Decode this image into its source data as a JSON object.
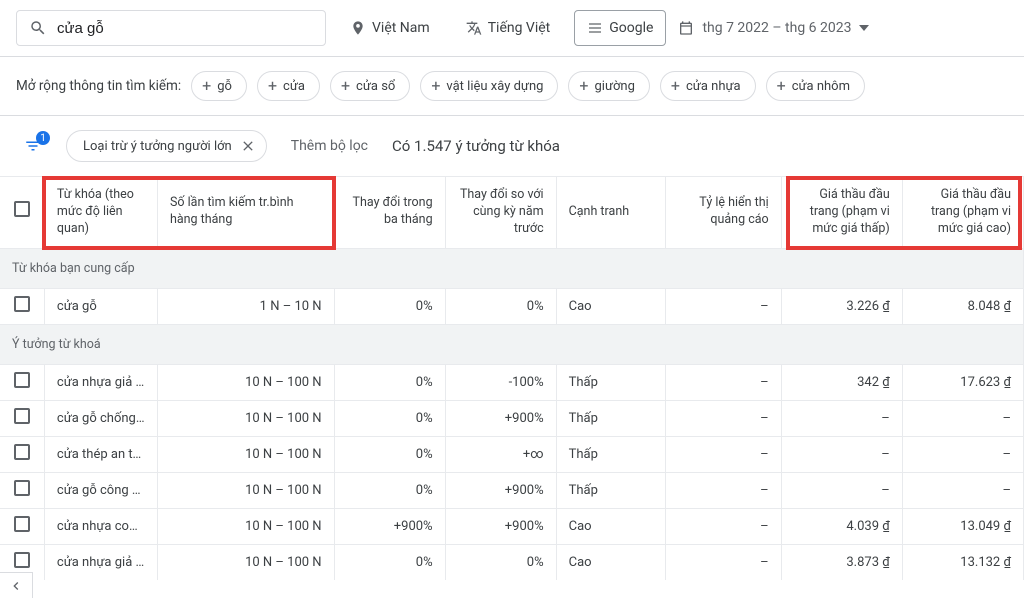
{
  "search": {
    "value": "cửa gỗ"
  },
  "top_filters": {
    "location": "Việt Nam",
    "language": "Tiếng Việt",
    "network": "Google",
    "date_range": "thg 7 2022 – thg 6 2023"
  },
  "broaden": {
    "label": "Mở rộng thông tin tìm kiếm:",
    "chips": [
      "gỗ",
      "cửa",
      "cửa sổ",
      "vật liệu xây dựng",
      "giường",
      "cửa nhựa",
      "cửa nhôm"
    ]
  },
  "filter_bar": {
    "badge": "1",
    "pill": "Loại trừ ý tưởng người lớn",
    "add_filter": "Thêm bộ lọc",
    "count": "Có 1.547 ý tưởng từ khóa"
  },
  "columns": {
    "keyword": "Từ khóa (theo mức độ liên quan)",
    "volume": "Số lần tìm kiếm tr.bình hàng tháng",
    "three_month": "Thay đổi trong ba tháng",
    "yoy": "Thay đổi so với cùng kỳ năm trước",
    "competition": "Cạnh tranh",
    "impression_share": "Tỷ lệ hiển thị quảng cáo",
    "bid_low": "Giá thầu đầu trang (phạm vi mức giá thấp)",
    "bid_high": "Giá thầu đầu trang (phạm vi mức giá cao)"
  },
  "sections": {
    "provided": "Từ khóa bạn cung cấp",
    "ideas": "Ý tưởng từ khoá"
  },
  "rows": {
    "provided": [
      {
        "kw": "cửa gỗ",
        "vol": "1 N – 10 N",
        "m3": "0%",
        "yoy": "0%",
        "comp": "Cao",
        "imp": "–",
        "low": "3.226 ₫",
        "high": "8.048 ₫"
      }
    ],
    "ideas": [
      {
        "kw": "cửa nhựa giả gỗ ...",
        "vol": "10 N – 100 N",
        "m3": "0%",
        "yoy": "-100%",
        "comp": "Thấp",
        "imp": "–",
        "low": "342 ₫",
        "high": "17.623 ₫"
      },
      {
        "kw": "cửa gỗ chống ch...",
        "vol": "10 N – 100 N",
        "m3": "0%",
        "yoy": "+900%",
        "comp": "Thấp",
        "imp": "–",
        "low": "–",
        "high": "–"
      },
      {
        "kw": "cửa thép an toàn...",
        "vol": "10 N – 100 N",
        "m3": "0%",
        "yoy": "+∞",
        "comp": "Thấp",
        "imp": "–",
        "low": "–",
        "high": "–"
      },
      {
        "kw": "cửa gỗ công ngh...",
        "vol": "10 N – 100 N",
        "m3": "0%",
        "yoy": "+900%",
        "comp": "Thấp",
        "imp": "–",
        "low": "–",
        "high": "–"
      },
      {
        "kw": "cửa nhựa compo...",
        "vol": "10 N – 100 N",
        "m3": "+900%",
        "yoy": "+900%",
        "comp": "Cao",
        "imp": "–",
        "low": "4.039 ₫",
        "high": "13.049 ₫"
      },
      {
        "kw": "cửa nhựa giả gỗ",
        "vol": "10 N – 100 N",
        "m3": "0%",
        "yoy": "0%",
        "comp": "Cao",
        "imp": "–",
        "low": "3.873 ₫",
        "high": "13.132 ₫"
      }
    ]
  }
}
